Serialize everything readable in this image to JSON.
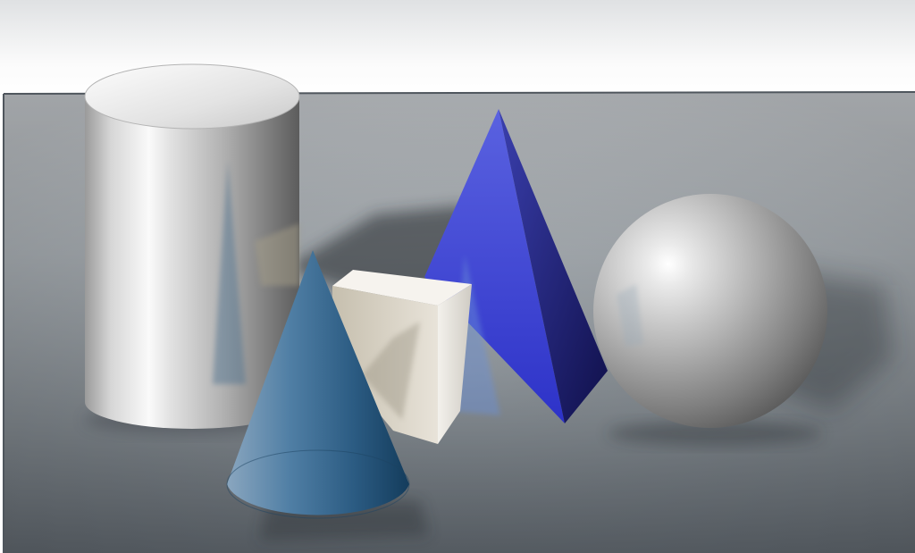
{
  "scene": {
    "background_top": "#f4f5f6",
    "table_far": "#c3c7cb",
    "table_near": "#5d646b",
    "table_edge": "#59616a",
    "shadow": "#1c2024"
  },
  "shapes": {
    "cylinder": {
      "color": "#c9c9c9",
      "highlight": "#ffffff",
      "shade": "#6c6c6c"
    },
    "cone": {
      "color": "#2f5f86",
      "light": "#7fa0bd",
      "dark": "#17405f"
    },
    "cube": {
      "top": "#f5f2ec",
      "front": "#d8d0bf",
      "side": "#f0eeea"
    },
    "pyramid": {
      "left": "#4d55d8",
      "right": "#2a2c98",
      "dark": "#151560"
    },
    "sphere": {
      "light": "#f8f8f8",
      "mid": "#b4b4b4",
      "dark": "#555555"
    }
  }
}
